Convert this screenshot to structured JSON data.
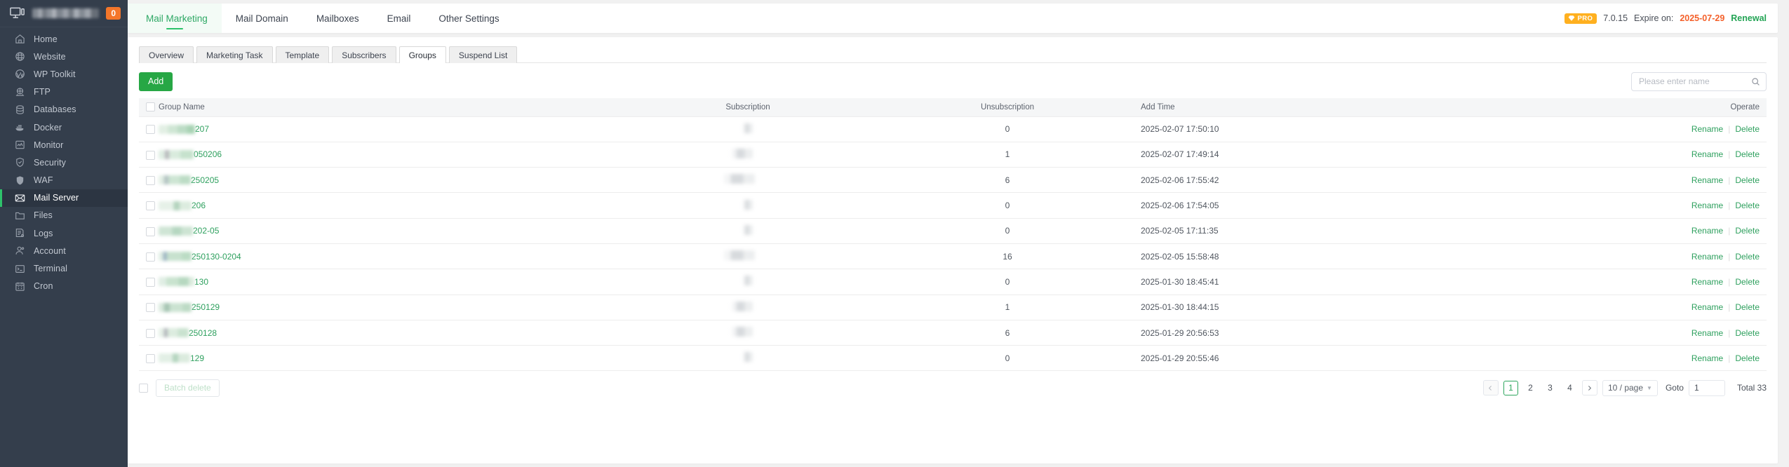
{
  "sidebar": {
    "logo": {
      "badge": "0",
      "icon": "monitor-icon"
    },
    "items": [
      {
        "label": "Home",
        "icon": "home-icon",
        "active": false
      },
      {
        "label": "Website",
        "icon": "globe-icon",
        "active": false
      },
      {
        "label": "WP Toolkit",
        "icon": "wordpress-icon",
        "active": false
      },
      {
        "label": "FTP",
        "icon": "ftp-icon",
        "active": false
      },
      {
        "label": "Databases",
        "icon": "database-icon",
        "active": false
      },
      {
        "label": "Docker",
        "icon": "docker-icon",
        "active": false
      },
      {
        "label": "Monitor",
        "icon": "monitor-chart-icon",
        "active": false
      },
      {
        "label": "Security",
        "icon": "shield-check-icon",
        "active": false
      },
      {
        "label": "WAF",
        "icon": "shield-icon",
        "active": false
      },
      {
        "label": "Mail Server",
        "icon": "envelope-icon",
        "active": true
      },
      {
        "label": "Files",
        "icon": "folder-icon",
        "active": false
      },
      {
        "label": "Logs",
        "icon": "logs-icon",
        "active": false
      },
      {
        "label": "Account",
        "icon": "user-icon",
        "active": false
      },
      {
        "label": "Terminal",
        "icon": "terminal-icon",
        "active": false
      },
      {
        "label": "Cron",
        "icon": "calendar-icon",
        "active": false
      }
    ]
  },
  "header": {
    "tabs": [
      {
        "label": "Mail Marketing",
        "active": true
      },
      {
        "label": "Mail Domain",
        "active": false
      },
      {
        "label": "Mailboxes",
        "active": false
      },
      {
        "label": "Email",
        "active": false
      },
      {
        "label": "Other Settings",
        "active": false
      }
    ],
    "pro_badge": "PRO",
    "version": "7.0.15",
    "expire_label": "Expire on:",
    "expire_date": "2025-07-29",
    "renewal": "Renewal"
  },
  "subtabs": [
    {
      "label": "Overview",
      "active": false
    },
    {
      "label": "Marketing Task",
      "active": false
    },
    {
      "label": "Template",
      "active": false
    },
    {
      "label": "Subscribers",
      "active": false
    },
    {
      "label": "Groups",
      "active": true
    },
    {
      "label": "Suspend List",
      "active": false
    }
  ],
  "toolbar": {
    "add_label": "Add",
    "search_placeholder": "Please enter name",
    "search_value": ""
  },
  "table": {
    "columns": [
      "Group Name",
      "Subscription",
      "Unsubscription",
      "Add Time",
      "Operate"
    ],
    "rows": [
      {
        "name_suffix": "207",
        "subscription": "",
        "unsubscription": "0",
        "add_time": "2025-02-07 17:50:10"
      },
      {
        "name_suffix": "050206",
        "subscription": "",
        "unsubscription": "1",
        "add_time": "2025-02-07 17:49:14"
      },
      {
        "name_suffix": "250205",
        "subscription": "",
        "unsubscription": "6",
        "add_time": "2025-02-06 17:55:42"
      },
      {
        "name_suffix": "206",
        "subscription": "",
        "unsubscription": "0",
        "add_time": "2025-02-06 17:54:05"
      },
      {
        "name_suffix": "202-05",
        "subscription": "",
        "unsubscription": "0",
        "add_time": "2025-02-05 17:11:35"
      },
      {
        "name_suffix": "250130-0204",
        "subscription": "",
        "unsubscription": "16",
        "add_time": "2025-02-05 15:58:48"
      },
      {
        "name_suffix": "130",
        "subscription": "",
        "unsubscription": "0",
        "add_time": "2025-01-30 18:45:41"
      },
      {
        "name_suffix": "250129",
        "subscription": "",
        "unsubscription": "1",
        "add_time": "2025-01-30 18:44:15"
      },
      {
        "name_suffix": "250128",
        "subscription": "",
        "unsubscription": "6",
        "add_time": "2025-01-29 20:56:53"
      },
      {
        "name_suffix": "129",
        "subscription": "",
        "unsubscription": "0",
        "add_time": "2025-01-29 20:55:46"
      }
    ],
    "row_actions": {
      "rename": "Rename",
      "delete": "Delete"
    }
  },
  "footer": {
    "batch_delete": "Batch delete",
    "prev": "‹",
    "next": "›",
    "pages": [
      "1",
      "2",
      "3",
      "4"
    ],
    "current_page": "1",
    "page_size": "10 / page",
    "goto_label": "Goto",
    "goto_value": "1",
    "total": "Total 33"
  },
  "colors": {
    "accent_green": "#2ea05e",
    "add_button": "#27a745",
    "badge_orange": "#f4762a",
    "pro_yellow": "#ffb01f",
    "expire_orange": "#f4602a",
    "sidebar_bg": "#343e4c"
  }
}
